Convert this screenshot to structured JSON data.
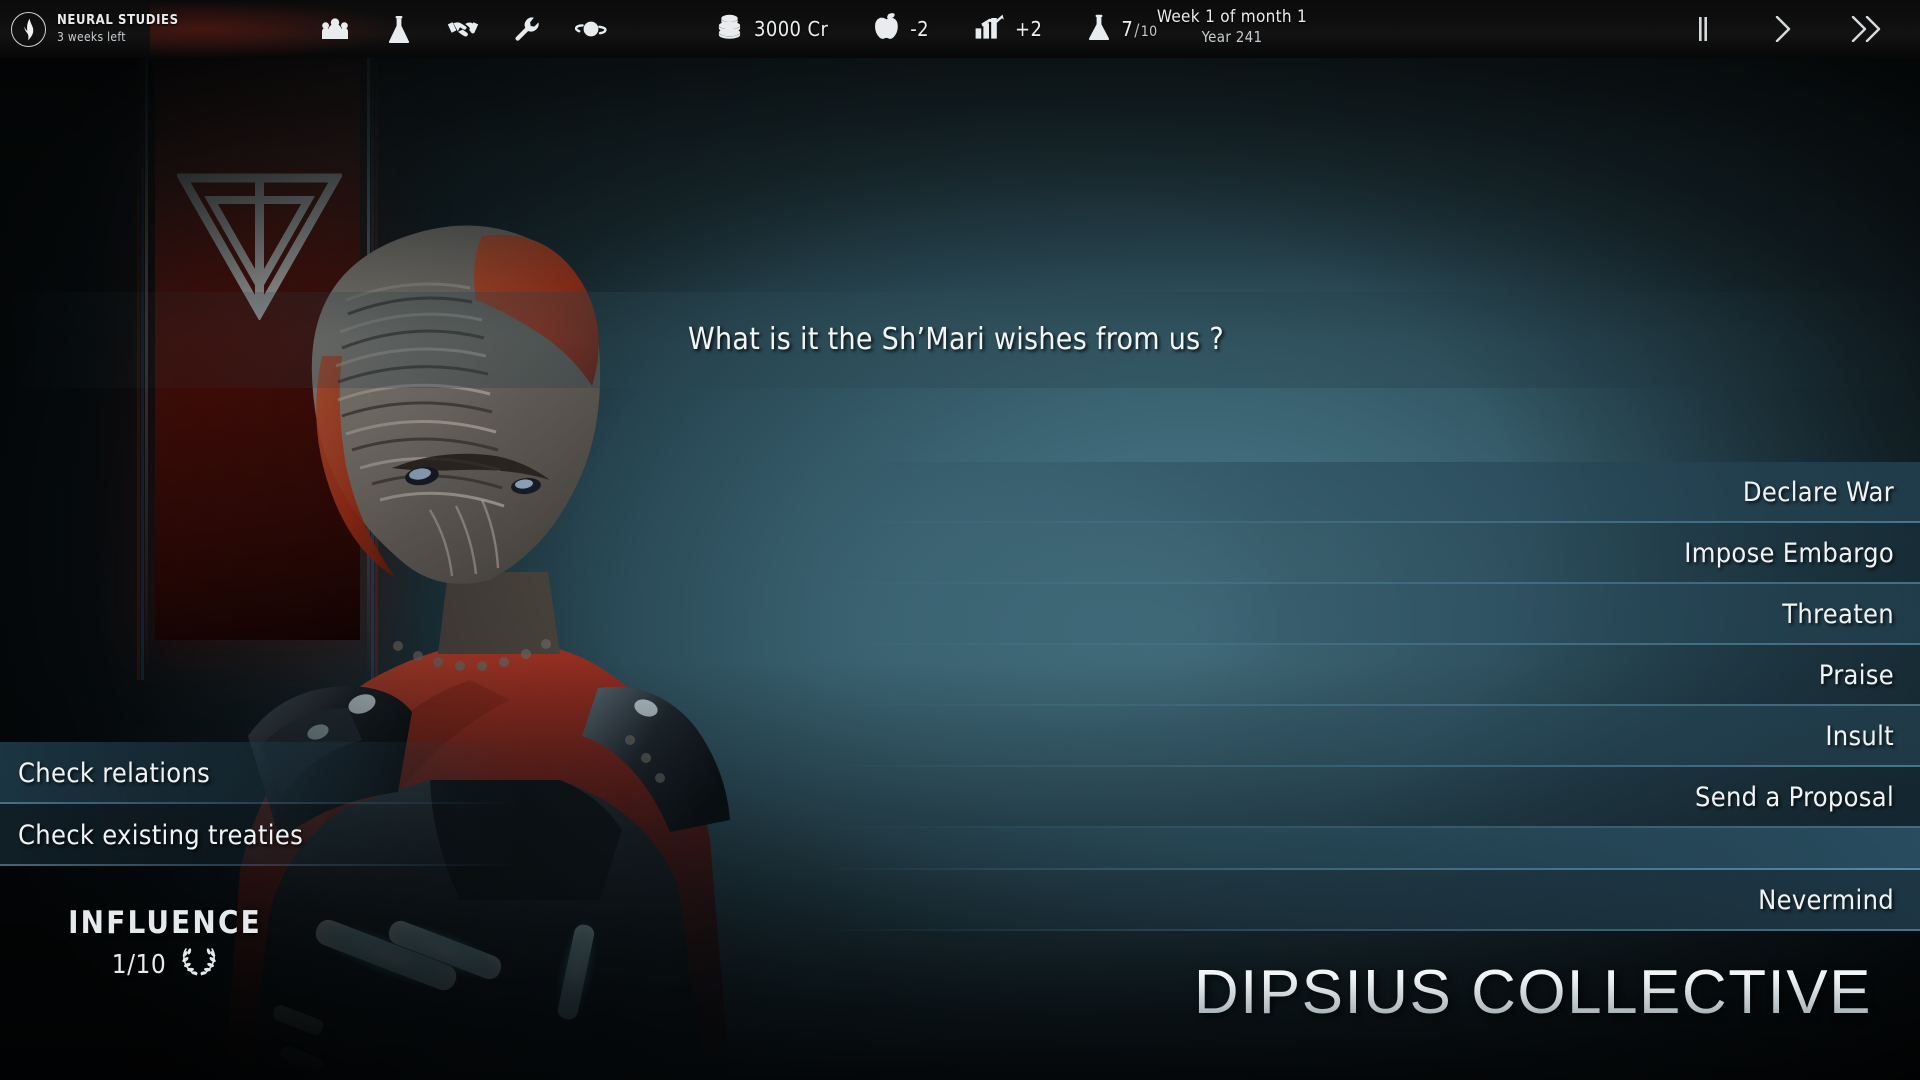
{
  "topbar": {
    "research": {
      "icon": "flame-icon",
      "title": "NEURAL STUDIES",
      "subtitle": "3 weeks left"
    },
    "nav_icons": [
      {
        "name": "population-icon",
        "label": "Population"
      },
      {
        "name": "research-flask-icon",
        "label": "Research"
      },
      {
        "name": "diplomacy-handshake-icon",
        "label": "Diplomacy"
      },
      {
        "name": "wrench-icon",
        "label": "Production"
      },
      {
        "name": "planet-icon",
        "label": "Planets"
      }
    ],
    "resources": [
      {
        "name": "credits",
        "icon": "coin-stack-icon",
        "value": "3000 Cr"
      },
      {
        "name": "food",
        "icon": "apple-icon",
        "value": "-2"
      },
      {
        "name": "production",
        "icon": "bar-chart-icon",
        "value": "+2"
      },
      {
        "name": "science",
        "icon": "flask-icon",
        "value": "7",
        "max": "10",
        "separator": "/"
      }
    ],
    "date": {
      "main": "Week 1 of month 1",
      "sub": "Year 241"
    },
    "speed_controls": [
      {
        "name": "pause-button",
        "glyph": "pause"
      },
      {
        "name": "play-button",
        "glyph": "play"
      },
      {
        "name": "fast-forward-button",
        "glyph": "fast-forward"
      }
    ]
  },
  "dialogue": {
    "prompt": "What is it the Sh’Mari wishes from us ?"
  },
  "right_menu": {
    "items": [
      {
        "label": "Declare War"
      },
      {
        "label": "Impose Embargo"
      },
      {
        "label": "Threaten"
      },
      {
        "label": "Praise"
      },
      {
        "label": "Insult"
      },
      {
        "label": "Send a Proposal"
      }
    ],
    "final_item": {
      "label": "Nevermind"
    }
  },
  "left_menu": {
    "items": [
      {
        "label": "Check relations"
      },
      {
        "label": "Check existing treaties"
      }
    ]
  },
  "influence": {
    "title": "INFLUENCE",
    "value": "1/10",
    "icon": "laurel-wreath-icon"
  },
  "faction": {
    "name": "DIPSIUS COLLECTIVE",
    "banner_emblem": "inverted-double-triangle-emblem",
    "banner_color": "#7d1a10"
  },
  "colors": {
    "accent_blue": "#2c5a6e",
    "panel_edge": "#60a0b6",
    "text_light": "#f0f3f5",
    "banner_red": "#7d1a10",
    "armor_glow": "#7fe6f5"
  }
}
